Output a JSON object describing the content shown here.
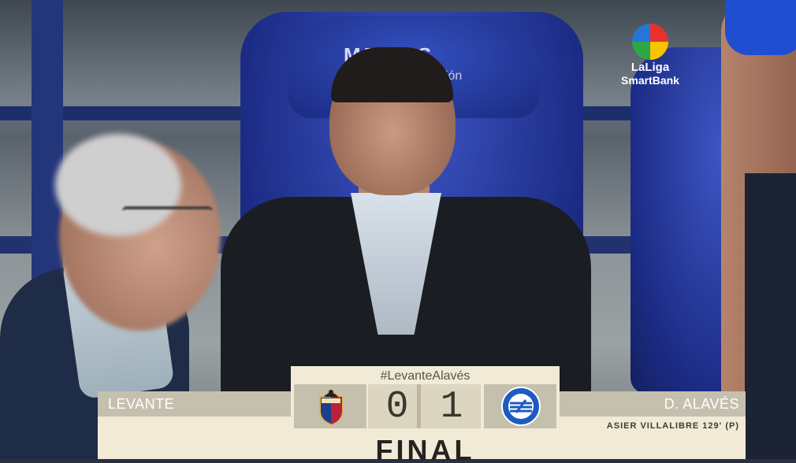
{
  "broadcast": {
    "hashtag": "#LevanteAlavés",
    "home_team": "LEVANTE",
    "away_team": "D. ALAVÉS",
    "home_score": "0",
    "away_score": "1",
    "status": "FINAL",
    "scorer": "ASIER VILLALIBRE   129' (P)"
  },
  "logo": {
    "line1": "LaLiga",
    "line2": "SmartBank"
  },
  "seat_branding": {
    "line1": "MEROS",
    "line2": "ación"
  },
  "crests": {
    "home_text": "LEVANTE U.D.",
    "away_text": "DEPORTIVO ALAVÉS"
  },
  "colors": {
    "scoreboard_cream": "#f1ead7",
    "scoreboard_tan": "#c5c0ad",
    "seat_blue": "#1c2c86"
  }
}
